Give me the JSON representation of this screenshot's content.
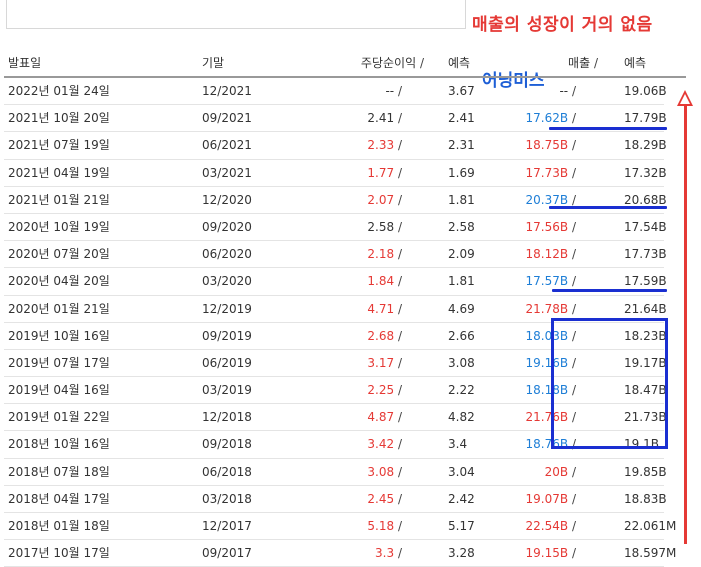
{
  "annotations": {
    "headline": "매출의 성장이 거의 없음",
    "earnings_miss": "어닝미스",
    "colors": {
      "red": "#e53935",
      "blue_annotation": "#1a2fd1",
      "blue_value": "#1e7ed6"
    }
  },
  "table": {
    "headers": {
      "date": "발표일",
      "period": "기말",
      "eps": "주당순이익",
      "eps_sep": "/",
      "eps_est": "예측",
      "revenue": "매출",
      "rev_sep": "/",
      "rev_est": "예측"
    },
    "rows": [
      {
        "date": "2022년 01월 24일",
        "period": "12/2021",
        "eps": "--",
        "eps_color": "neutral",
        "eps_est": "3.67",
        "rev": "--",
        "rev_color": "neutral",
        "rev_est": "19.06B"
      },
      {
        "date": "2021년 10월 20일",
        "period": "09/2021",
        "eps": "2.41",
        "eps_color": "neutral",
        "eps_est": "2.41",
        "rev": "17.62B",
        "rev_color": "blue",
        "rev_est": "17.79B"
      },
      {
        "date": "2021년 07월 19일",
        "period": "06/2021",
        "eps": "2.33",
        "eps_color": "red",
        "eps_est": "2.31",
        "rev": "18.75B",
        "rev_color": "red",
        "rev_est": "18.29B"
      },
      {
        "date": "2021년 04월 19일",
        "period": "03/2021",
        "eps": "1.77",
        "eps_color": "red",
        "eps_est": "1.69",
        "rev": "17.73B",
        "rev_color": "red",
        "rev_est": "17.32B"
      },
      {
        "date": "2021년 01월 21일",
        "period": "12/2020",
        "eps": "2.07",
        "eps_color": "red",
        "eps_est": "1.81",
        "rev": "20.37B",
        "rev_color": "blue",
        "rev_est": "20.68B"
      },
      {
        "date": "2020년 10월 19일",
        "period": "09/2020",
        "eps": "2.58",
        "eps_color": "neutral",
        "eps_est": "2.58",
        "rev": "17.56B",
        "rev_color": "red",
        "rev_est": "17.54B"
      },
      {
        "date": "2020년 07월 20일",
        "period": "06/2020",
        "eps": "2.18",
        "eps_color": "red",
        "eps_est": "2.09",
        "rev": "18.12B",
        "rev_color": "red",
        "rev_est": "17.73B"
      },
      {
        "date": "2020년 04월 20일",
        "period": "03/2020",
        "eps": "1.84",
        "eps_color": "red",
        "eps_est": "1.81",
        "rev": "17.57B",
        "rev_color": "blue",
        "rev_est": "17.59B"
      },
      {
        "date": "2020년 01월 21일",
        "period": "12/2019",
        "eps": "4.71",
        "eps_color": "red",
        "eps_est": "4.69",
        "rev": "21.78B",
        "rev_color": "red",
        "rev_est": "21.64B"
      },
      {
        "date": "2019년 10월 16일",
        "period": "09/2019",
        "eps": "2.68",
        "eps_color": "red",
        "eps_est": "2.66",
        "rev": "18.03B",
        "rev_color": "blue",
        "rev_est": "18.23B"
      },
      {
        "date": "2019년 07월 17일",
        "period": "06/2019",
        "eps": "3.17",
        "eps_color": "red",
        "eps_est": "3.08",
        "rev": "19.16B",
        "rev_color": "blue",
        "rev_est": "19.17B"
      },
      {
        "date": "2019년 04월 16일",
        "period": "03/2019",
        "eps": "2.25",
        "eps_color": "red",
        "eps_est": "2.22",
        "rev": "18.18B",
        "rev_color": "blue",
        "rev_est": "18.47B"
      },
      {
        "date": "2019년 01월 22일",
        "period": "12/2018",
        "eps": "4.87",
        "eps_color": "red",
        "eps_est": "4.82",
        "rev": "21.76B",
        "rev_color": "red",
        "rev_est": "21.73B"
      },
      {
        "date": "2018년 10월 16일",
        "period": "09/2018",
        "eps": "3.42",
        "eps_color": "red",
        "eps_est": "3.4",
        "rev": "18.76B",
        "rev_color": "blue",
        "rev_est": "19.1B"
      },
      {
        "date": "2018년 07월 18일",
        "period": "06/2018",
        "eps": "3.08",
        "eps_color": "red",
        "eps_est": "3.04",
        "rev": "20B",
        "rev_color": "red",
        "rev_est": "19.85B"
      },
      {
        "date": "2018년 04월 17일",
        "period": "03/2018",
        "eps": "2.45",
        "eps_color": "red",
        "eps_est": "2.42",
        "rev": "19.07B",
        "rev_color": "red",
        "rev_est": "18.83B"
      },
      {
        "date": "2018년 01월 18일",
        "period": "12/2017",
        "eps": "5.18",
        "eps_color": "red",
        "eps_est": "5.17",
        "rev": "22.54B",
        "rev_color": "red",
        "rev_est": "22.061M"
      },
      {
        "date": "2017년 10월 17일",
        "period": "09/2017",
        "eps": "3.3",
        "eps_color": "red",
        "eps_est": "3.28",
        "rev": "19.15B",
        "rev_color": "red",
        "rev_est": "18.597M"
      }
    ]
  }
}
